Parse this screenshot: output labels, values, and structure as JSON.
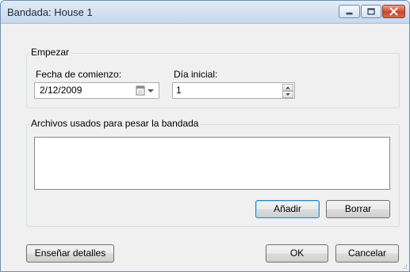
{
  "window": {
    "title": "Bandada: House 1"
  },
  "start_group": {
    "legend": "Empezar",
    "start_date_label": "Fecha de comienzo:",
    "start_date_value": "2/12/2009",
    "start_day_label": "Día inicial:",
    "start_day_value": "1"
  },
  "files_group": {
    "legend": "Archivos usados para pesar la bandada",
    "add_label": "Añadir",
    "delete_label": "Borrar"
  },
  "footer": {
    "details_label": "Enseñar detalles",
    "ok_label": "OK",
    "cancel_label": "Cancelar"
  },
  "colors": {
    "title_bar": "#d3e1f1",
    "close_button": "#c9462c",
    "default_button_border": "#3c7fb1"
  },
  "icons": {
    "date_picker": "calendar-icon",
    "dropdown": "chevron-down-icon",
    "spin": "spin-arrows-icon"
  }
}
